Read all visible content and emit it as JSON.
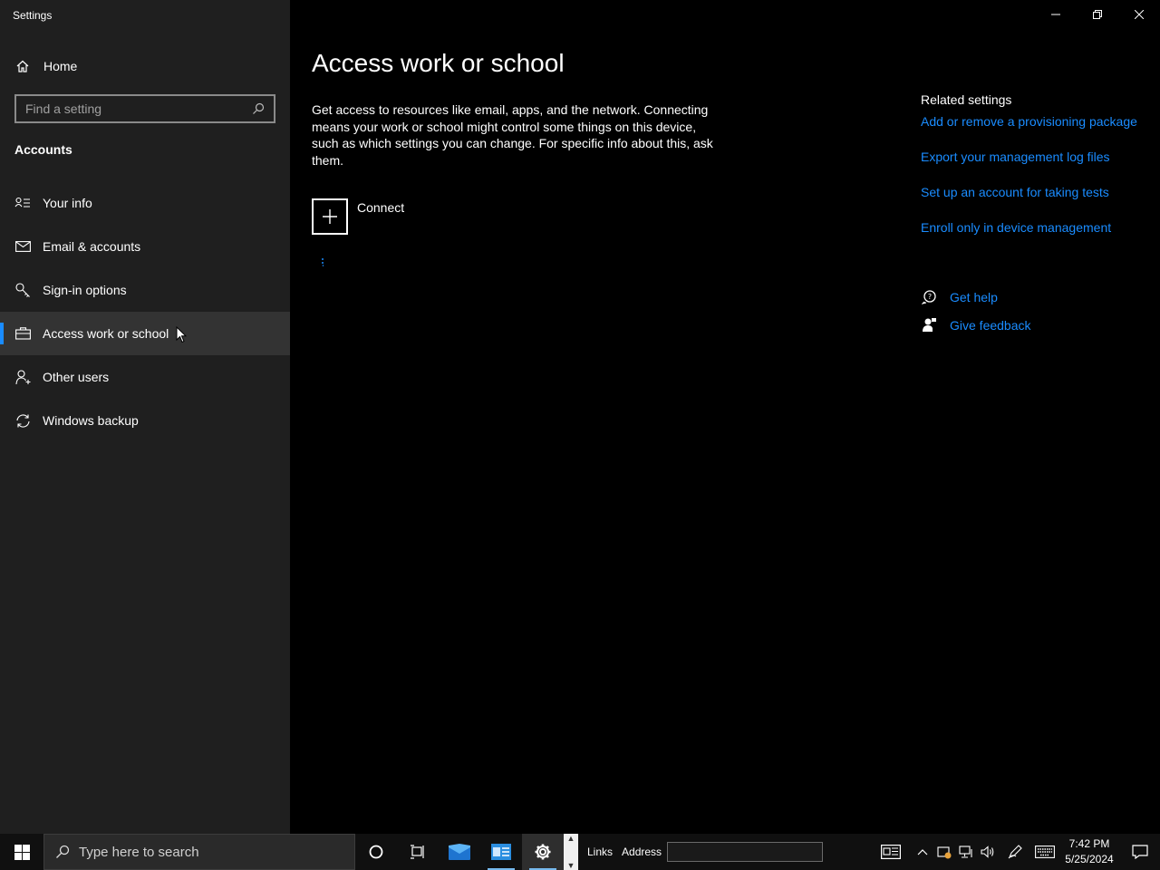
{
  "window": {
    "title": "Settings"
  },
  "sidebar": {
    "home_label": "Home",
    "search_placeholder": "Find a setting",
    "section_title": "Accounts",
    "items": [
      {
        "label": "Your info",
        "icon": "contact-card-icon"
      },
      {
        "label": "Email & accounts",
        "icon": "mail-icon"
      },
      {
        "label": "Sign-in options",
        "icon": "key-icon"
      },
      {
        "label": "Access work or school",
        "icon": "briefcase-icon",
        "active": true
      },
      {
        "label": "Other users",
        "icon": "add-person-icon"
      },
      {
        "label": "Windows backup",
        "icon": "sync-icon"
      }
    ]
  },
  "main": {
    "title": "Access work or school",
    "description": "Get access to resources like email, apps, and the network. Connecting means your work or school might control some things on this device, such as which settings you can change. For specific info about this, ask them.",
    "connect_label": "Connect"
  },
  "related": {
    "heading": "Related settings",
    "links": [
      "Add or remove a provisioning package",
      "Export your management log files",
      "Set up an account for taking tests",
      "Enroll only in device management"
    ],
    "help_label": "Get help",
    "feedback_label": "Give feedback"
  },
  "taskbar": {
    "search_placeholder": "Type here to search",
    "links_label": "Links",
    "address_label": "Address",
    "time": "7:42 PM",
    "date": "5/25/2024"
  },
  "colors": {
    "accent": "#1a8cff",
    "sidebar_bg": "#1f1f1f",
    "main_bg": "#000000"
  }
}
